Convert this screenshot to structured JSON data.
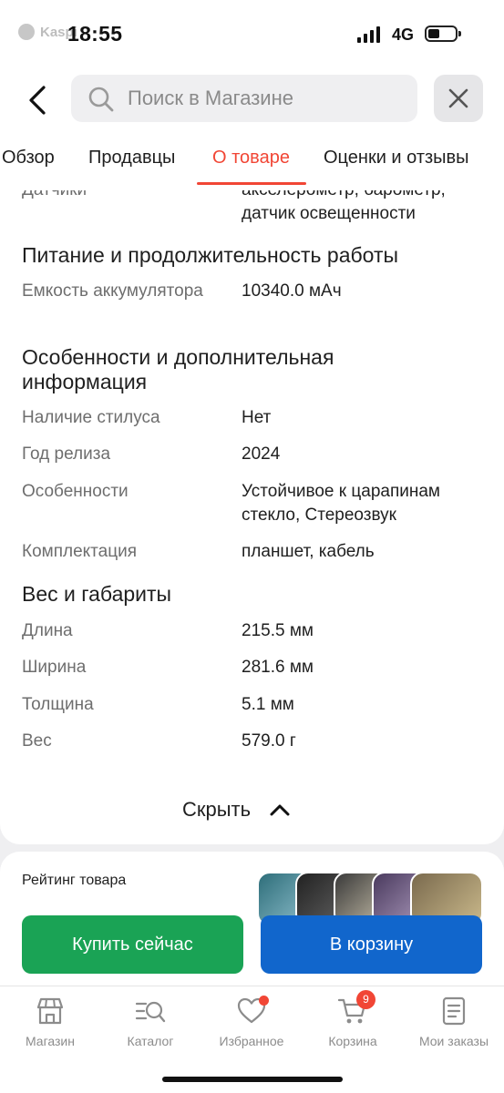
{
  "status_bar": {
    "app_badge": "Kaspi",
    "time": "18:55",
    "network": "4G"
  },
  "header": {
    "search_placeholder": "Поиск в Магазине",
    "tabs": [
      {
        "label": "Обзор",
        "active": false
      },
      {
        "label": "Продавцы",
        "active": false
      },
      {
        "label": "О товаре",
        "active": true
      },
      {
        "label": "Оценки и отзывы",
        "active": false
      }
    ]
  },
  "specs": {
    "sensors": {
      "label": "Датчики",
      "value": "акселерометр, барометр, датчик освещенности"
    },
    "power": {
      "title": "Питание и продолжительность работы",
      "battery": {
        "label": "Емкость аккумулятора",
        "value": "10340.0 мАч"
      }
    },
    "features": {
      "title": "Особенности и дополнительная информация",
      "stylus": {
        "label": "Наличие стилуса",
        "value": "Нет"
      },
      "release_year": {
        "label": "Год релиза",
        "value": "2024"
      },
      "special": {
        "label": "Особенности",
        "value": "Устойчивое к царапинам стекло, Стереозвук"
      },
      "package": {
        "label": "Комплектация",
        "value": "планшет, кабель"
      }
    },
    "dimensions": {
      "title": "Вес и габариты",
      "length": {
        "label": "Длина",
        "value": "215.5 мм"
      },
      "width": {
        "label": "Ширина",
        "value": "281.6 мм"
      },
      "thickness": {
        "label": "Толщина",
        "value": "5.1 мм"
      },
      "weight": {
        "label": "Вес",
        "value": "579.0 г"
      }
    },
    "hide_label": "Скрыть"
  },
  "rating": {
    "title": "Рейтинг товара"
  },
  "actions": {
    "buy_now": "Купить сейчас",
    "add_to_cart": "В корзину"
  },
  "bottom_nav": {
    "items": [
      {
        "label": "Магазин",
        "icon": "store-icon"
      },
      {
        "label": "Каталог",
        "icon": "catalog-search-icon"
      },
      {
        "label": "Избранное",
        "icon": "heart-icon"
      },
      {
        "label": "Корзина",
        "icon": "cart-icon"
      },
      {
        "label": "Мои заказы",
        "icon": "orders-icon"
      }
    ],
    "cart_count": "9"
  },
  "colors": {
    "accent_red": "#f14635",
    "buy_green": "#1aa355",
    "cart_blue": "#1166cc"
  }
}
